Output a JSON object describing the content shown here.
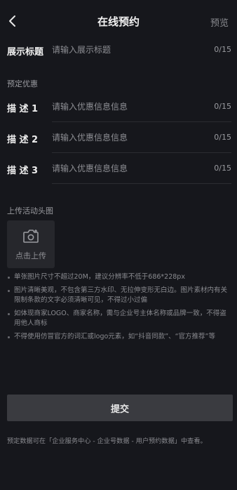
{
  "nav": {
    "title": "在线预约",
    "preview_label": "预览"
  },
  "fields": [
    {
      "label": "展示标题",
      "placeholder": "请输入展示标题",
      "value": "",
      "count": "0/15"
    },
    {
      "label": "描 述 1",
      "placeholder": "请输入优惠信息信息",
      "value": "",
      "count": "0/15"
    },
    {
      "label": "描 述 2",
      "placeholder": "请输入优惠信息信息",
      "value": "",
      "count": "0/15"
    },
    {
      "label": "描 述 3",
      "placeholder": "请输入优惠信息信息",
      "value": "",
      "count": "0/15"
    }
  ],
  "sections": {
    "discount_label": "预定优惠",
    "upload_label": "上传活动头图"
  },
  "upload": {
    "icon": "camera-icon",
    "label": "点击上传"
  },
  "tips": [
    "单张图片尺寸不超过20M，建议分辨率不低于686*228px",
    "图片清晰美观，不包含第三方水印、无拉伸变形无白边。图片素材内有关限制条款的文字必须清晰可见，不得过小过偏",
    "如体现商家LOGO、商家名称，需与企业号主体名称或品牌一致，不得盗用他人商标",
    "不得使用仿冒官方的词汇或logo元素，如“抖音同款”、“官方推荐”等"
  ],
  "submit_label": "提交",
  "footer_note": "预定数据可在「企业服务中心 - 企业号数据 - 用户预约数据」中查看。",
  "colors": {
    "background": "#16171c",
    "button": "#3a3b40",
    "muted_text": "#8a8b90"
  }
}
